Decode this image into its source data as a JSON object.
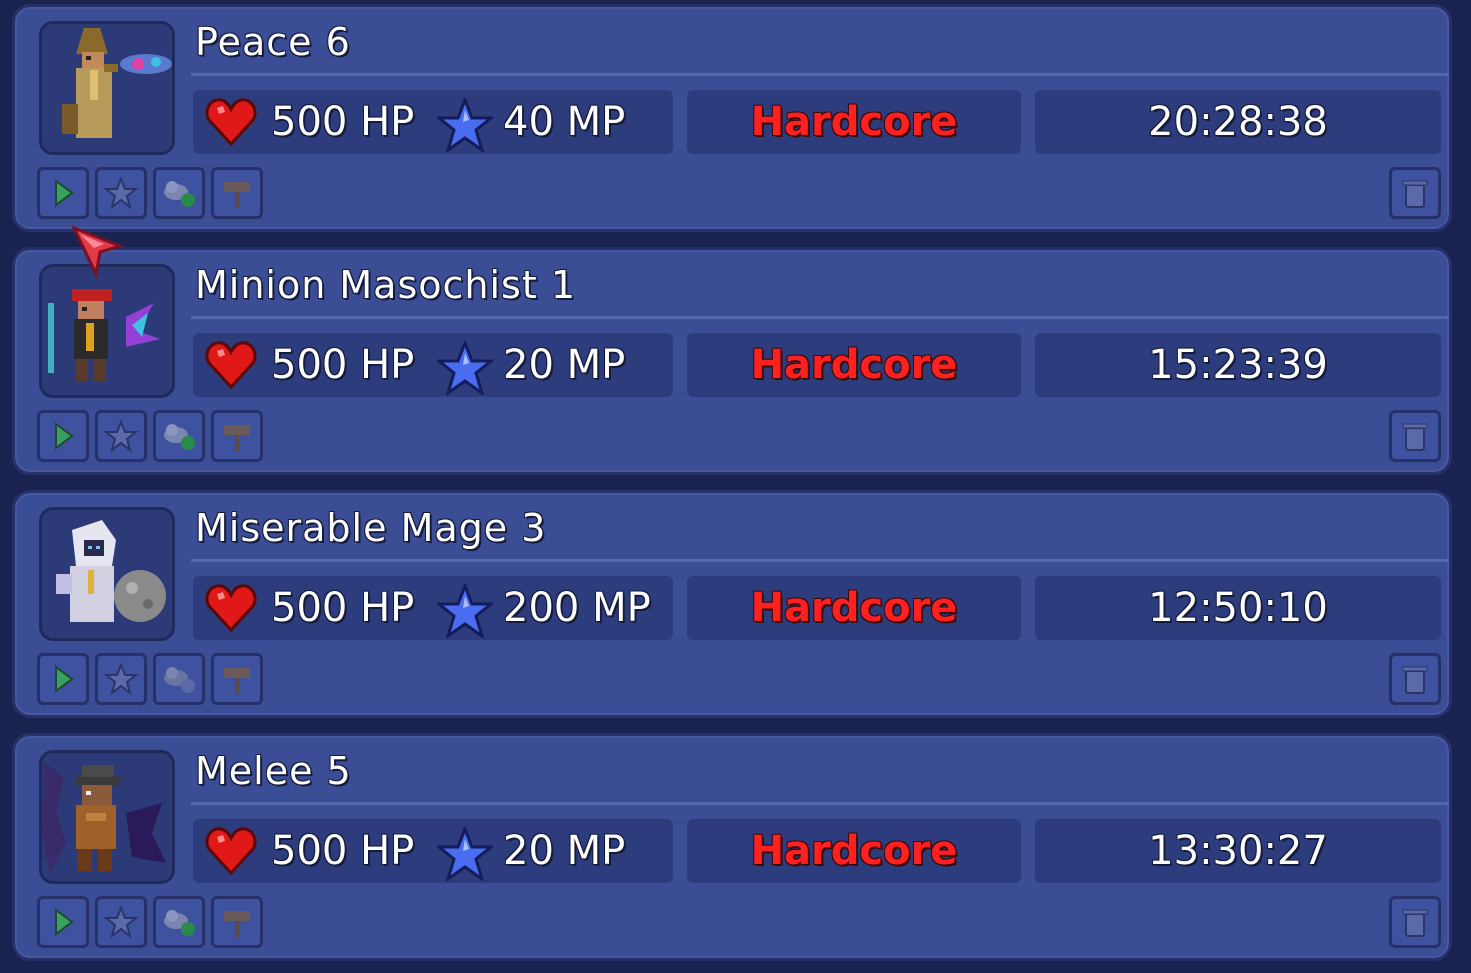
{
  "characters": [
    {
      "name": "Peace 6",
      "hp": "500 HP",
      "mp": "40 MP",
      "difficulty": "Hardcore",
      "playtime": "20:28:38",
      "portrait_icon": "robed-mage-character-icon"
    },
    {
      "name": "Minion Masochist 1",
      "hp": "500 HP",
      "mp": "20 MP",
      "difficulty": "Hardcore",
      "playtime": "15:23:39",
      "portrait_icon": "red-hat-summoner-character-icon"
    },
    {
      "name": "Miserable Mage 3",
      "hp": "500 HP",
      "mp": "200 MP",
      "difficulty": "Hardcore",
      "playtime": "12:50:10",
      "portrait_icon": "hooded-white-mage-character-icon"
    },
    {
      "name": "Melee 5",
      "hp": "500 HP",
      "mp": "20 MP",
      "difficulty": "Hardcore",
      "playtime": "13:30:27",
      "portrait_icon": "dark-armored-warrior-character-icon"
    }
  ],
  "colors": {
    "background": "#1a2350",
    "card": "#3b4d95",
    "stat_box": "#2d3c7c",
    "hardcore_text": "#ff2020",
    "heart": "#e01818",
    "star": "#4a6cf0"
  },
  "icons": {
    "hp": "heart-icon",
    "mp": "mana-star-icon",
    "play": "play-icon",
    "favorite": "star-outline-icon",
    "cloud": "cloud-sync-icon",
    "rename": "signpost-icon",
    "delete": "trash-icon",
    "cursor": "cursor-arrow-icon"
  }
}
